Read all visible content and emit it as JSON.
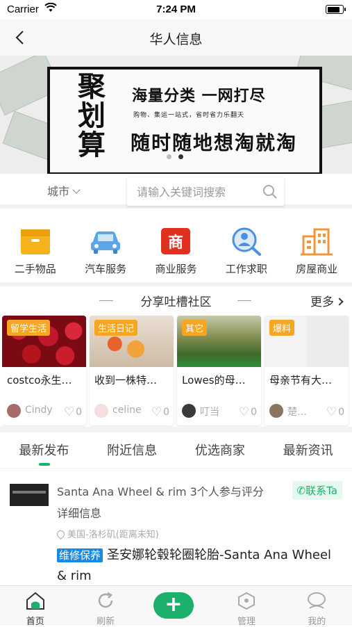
{
  "status_bar": {
    "carrier": "Carrier",
    "time": "7:24 PM"
  },
  "nav": {
    "title": "华人信息"
  },
  "banner": {
    "big_text": "聚划算",
    "slogan_top": "海量分类 一网打尽",
    "slogan_small": "购物、集运一站式，省时省力乐翻天",
    "slogan_bottom": "随时随地想淘就淘"
  },
  "search": {
    "city_label": "城市",
    "placeholder": "请输入关键词搜索"
  },
  "categories": [
    {
      "label": "二手物品",
      "icon": "box-icon",
      "color": "#f5b21b"
    },
    {
      "label": "汽车服务",
      "icon": "car-icon",
      "color": "#5aa6e8"
    },
    {
      "label": "商业服务",
      "icon": "shop-icon",
      "color": "#e0311f"
    },
    {
      "label": "工作求职",
      "icon": "job-search-icon",
      "color": "#4a90e2"
    },
    {
      "label": "房屋商业",
      "icon": "building-icon",
      "color": "#f0953a"
    }
  ],
  "community": {
    "title": "分享吐槽社区",
    "more": "更多",
    "cards": [
      {
        "tag": "留学生活",
        "title": "costco永生…",
        "author": "Cindy",
        "likes": "0"
      },
      {
        "tag": "生活日记",
        "title": "收到一株特…",
        "author": "celine",
        "likes": "0"
      },
      {
        "tag": "其它",
        "title": "Lowes的母…",
        "author": "叮当",
        "likes": "0"
      },
      {
        "tag": "爆料",
        "title": "母亲节有大…",
        "author": "楚…",
        "likes": "0"
      }
    ]
  },
  "tabs": [
    "最新发布",
    "附近信息",
    "优选商家",
    "最新资讯"
  ],
  "listing": {
    "header": "Santa Ana Wheel & rim 3个人参与评分",
    "contact": "联系Ta",
    "detail": "详细信息",
    "location": "美国-洛杉矶(距离未知)",
    "badge": "维修保养",
    "description": "圣安娜轮毂轮圈轮胎-Santa Ana Wheel & rim"
  },
  "tabbar": {
    "home": "首页",
    "refresh": "刷新",
    "add": "+",
    "manage": "管理",
    "mine": "我的"
  },
  "colors": {
    "accent": "#1bb06b",
    "tag": "#f5a623",
    "badge": "#1a8ae0"
  }
}
